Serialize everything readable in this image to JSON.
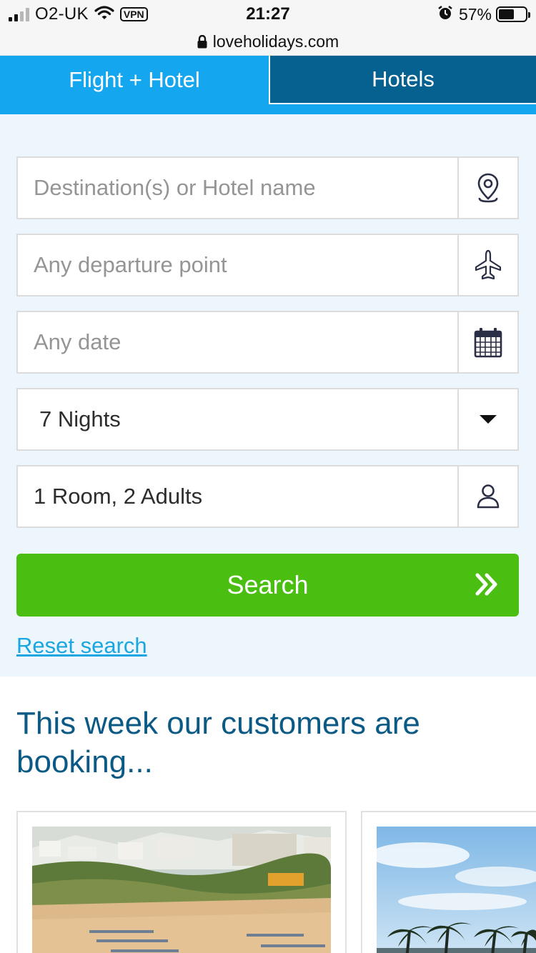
{
  "status_bar": {
    "carrier": "O2-UK",
    "vpn": "VPN",
    "time": "21:27",
    "battery_percent": "57%",
    "battery_level": 0.57
  },
  "browser": {
    "url": "loveholidays.com"
  },
  "tabs": [
    {
      "label": "Flight + Hotel",
      "active": true
    },
    {
      "label": "Hotels",
      "active": false
    }
  ],
  "search_form": {
    "destination_placeholder": "Destination(s) or Hotel name",
    "departure_placeholder": "Any departure point",
    "date_placeholder": "Any date",
    "nights_value": "7 Nights",
    "rooms_value": "1 Room, 2 Adults",
    "search_label": "Search",
    "reset_label": "Reset search"
  },
  "section": {
    "title": "This week our customers are booking..."
  },
  "icons": {
    "destination": "map-pin-icon",
    "departure": "airplane-icon",
    "date": "calendar-icon",
    "nights": "dropdown-caret-icon",
    "rooms": "person-icon",
    "search": "double-chevron-right-icon"
  },
  "colors": {
    "tab_active": "#14a6ee",
    "tab_inactive": "#05618f",
    "panel_bg": "#edf6fc",
    "search_button": "#4bbe12",
    "heading": "#0a5a85",
    "link": "#1aa6e0"
  }
}
